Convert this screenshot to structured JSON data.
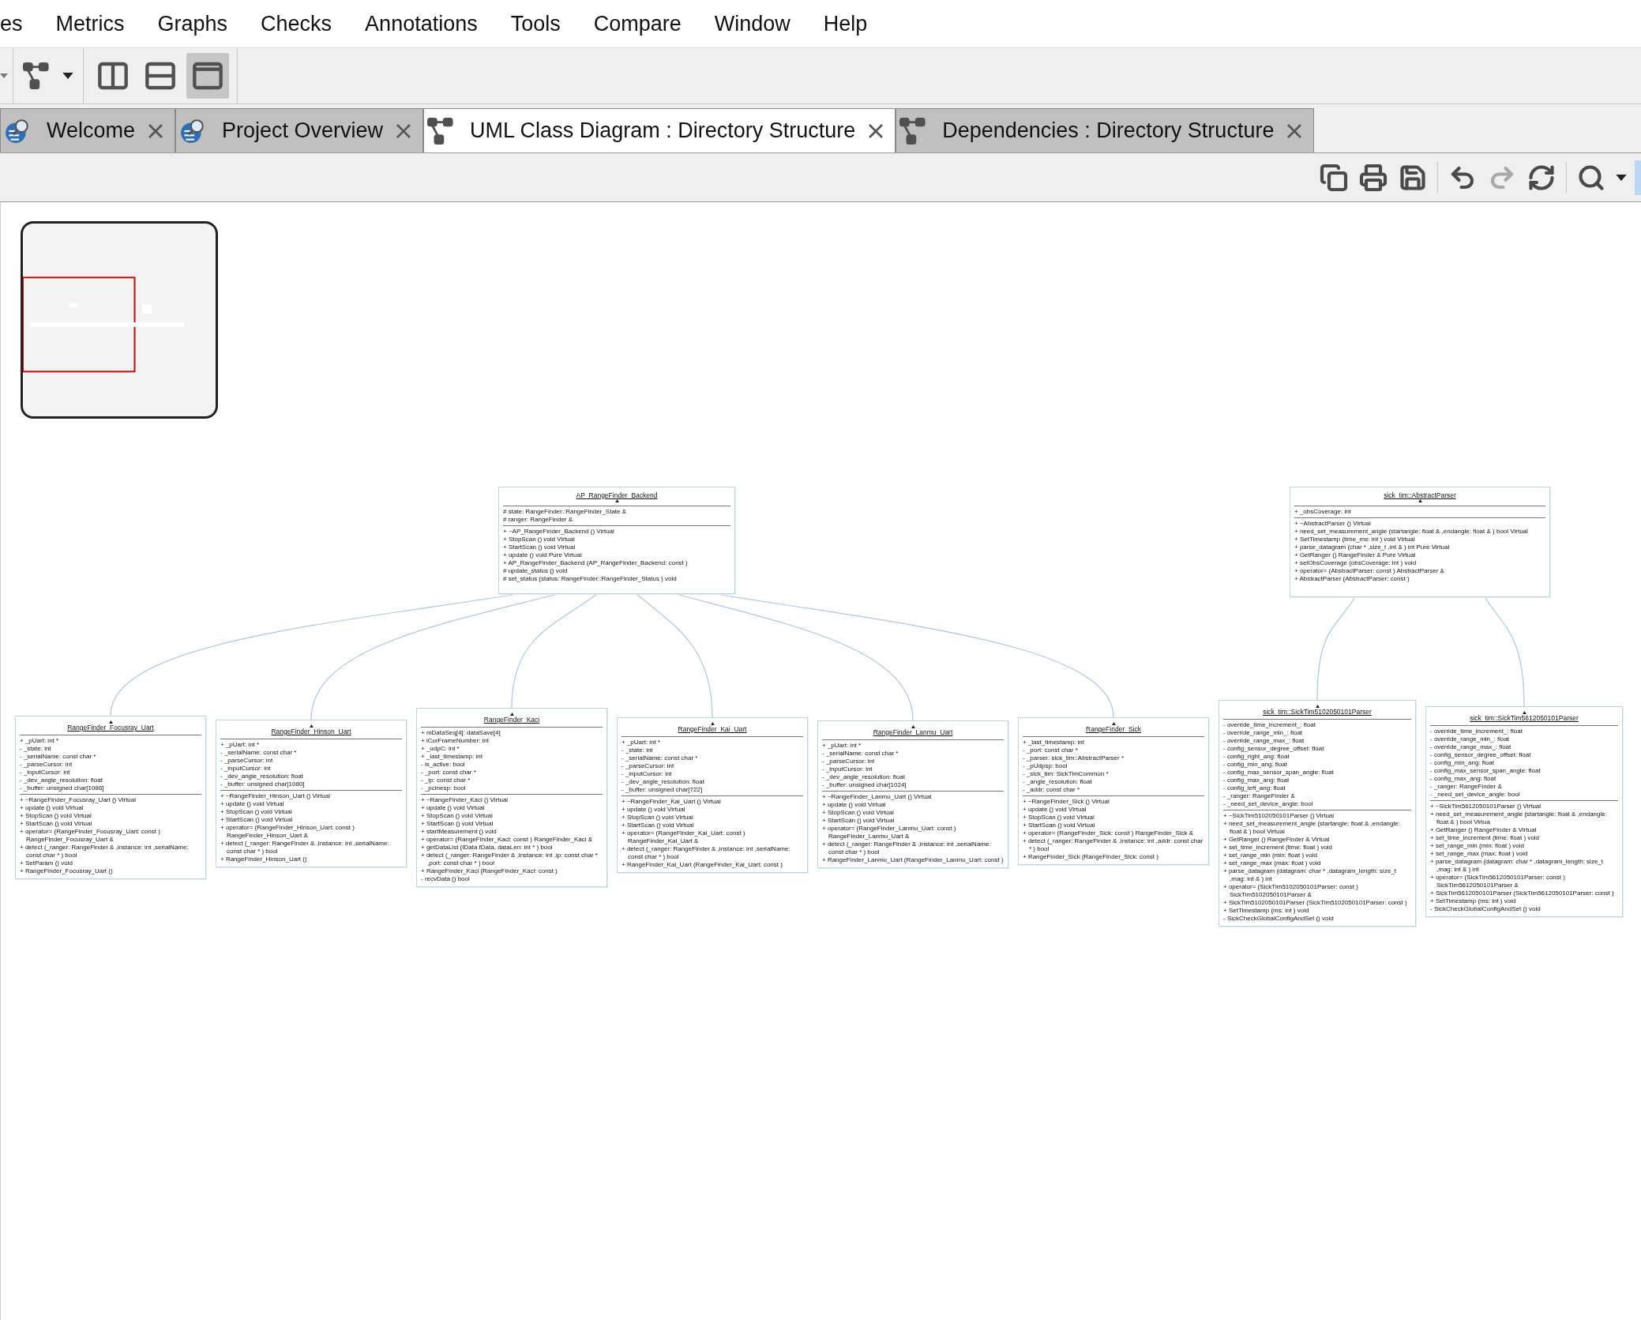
{
  "menu": [
    {
      "label": "es"
    },
    {
      "label": "Metrics"
    },
    {
      "label": "Graphs"
    },
    {
      "label": "Checks"
    },
    {
      "label": "Annotations"
    },
    {
      "label": "Tools"
    },
    {
      "label": "Compare"
    },
    {
      "label": "Window"
    },
    {
      "label": "Help"
    }
  ],
  "view_buttons": [
    {
      "kind": "columns",
      "selected": false
    },
    {
      "kind": "rows",
      "selected": false
    },
    {
      "kind": "single",
      "selected": true
    }
  ],
  "tabs": [
    {
      "label": "Welcome",
      "kind": "overview",
      "selected": false
    },
    {
      "label": "Project Overview",
      "kind": "overview",
      "selected": false
    },
    {
      "label": "UML Class Diagram : Directory Structure",
      "kind": "graph",
      "selected": true
    },
    {
      "label": "Dependencies : Directory Structure",
      "kind": "graph",
      "selected": false
    }
  ],
  "diagram_tools": [
    {
      "kind": "copy",
      "disabled": false
    },
    {
      "kind": "print",
      "disabled": false
    },
    {
      "kind": "save",
      "disabled": false
    },
    {
      "kind": "undo",
      "disabled": false
    },
    {
      "kind": "redo",
      "disabled": true
    },
    {
      "kind": "refresh",
      "disabled": false
    },
    {
      "kind": "search",
      "disabled": false
    }
  ],
  "classes": [
    {
      "name": "AP_RangeFinder_Backend",
      "attributes": [
        "# state: RangeFinder::RangeFinder_State &",
        "# ranger: RangeFinder &"
      ],
      "methods": [
        "+ ~AP_RangeFinder_Backend () Virtual",
        "+ StopScan () void Virtual",
        "+ StartScan () void Virtual",
        "+ update () void Pure Virtual",
        "+ AP_RangeFinder_Backend (AP_RangeFinder_Backend: const )",
        "# update_status () void",
        "# set_status (status: RangeFinder::RangeFinder_Status ) void"
      ],
      "children": [
        {
          "name": "RangeFinder_Focusray_Uart",
          "attributes": [
            "+ _pUart: int *",
            "- _state: int",
            "- _serialName: const char *",
            "- _parseCursor: int",
            "- _inputCursor: int",
            "- _dev_angle_resolution: float",
            "- _buffer: unsigned char[1086]"
          ],
          "methods": [
            "+ ~RangeFinder_Focusray_Uart () Virtual",
            "+ update () void Virtual",
            "+ StopScan () void Virtual",
            "+ StartScan () void Virtual",
            "+ operator= (RangeFinder_Focusray_Uart: const ) RangeFinder_Focusray_Uart &",
            "+ detect (_ranger: RangeFinder & ,instance: int ,serialName: const char * ) bool",
            "+ SetParam () void",
            "+ RangeFinder_Focusray_Uart ()"
          ]
        },
        {
          "name": "RangeFinder_Hinson_Uart",
          "attributes": [
            "+ _pUart: int *",
            "- _serialName: const char *",
            "- _parseCursor: int",
            "- _inputCursor: int",
            "- _dev_angle_resolution: float",
            "- _buffer: unsigned char[1080]"
          ],
          "methods": [
            "+ ~RangeFinder_Hinson_Uart () Virtual",
            "+ update () void Virtual",
            "+ StopScan () void Virtual",
            "+ StartScan () void Virtual",
            "+ operator= (RangeFinder_Hinson_Uart: const ) RangeFinder_Hinson_Uart &",
            "+ detect (_ranger: RangeFinder & ,instance: int ,serialName: const char * ) bool",
            "+ RangeFinder_Hinson_Uart ()"
          ]
        },
        {
          "name": "RangeFinder_Kaci",
          "attributes": [
            "+ mDataSeq[4]: dataSave[4]",
            "+ iCurFrameNumber: int",
            "+ _udpC: int *",
            "+ _last_timestamp: int",
            "- is_active: bool",
            "- _port: const char *",
            "- _ip: const char *",
            "- _pcinesp: bool"
          ],
          "methods": [
            "+ ~RangeFinder_Kaci () Virtual",
            "+ update () void Virtual",
            "+ StopScan () void Virtual",
            "+ StartScan () void Virtual",
            "+ startMeasurement () void",
            "+ operator= (RangeFinder_Kaci: const ) RangeFinder_Kaci &",
            "+ getDataList (IData fData, dataLen: int * ) bool",
            "+ detect (_ranger: RangeFinder & ,instance: int ,ip: const char * ,port: const char * ) bool",
            "+ RangeFinder_Kaci (RangeFinder_Kaci: const )",
            "- recvData () bool"
          ]
        },
        {
          "name": "RangeFinder_Kai_Uart",
          "attributes": [
            "+ _pUart: int *",
            "- _state: int",
            "- _serialName: const char *",
            "- _parseCursor: int",
            "- _inputCursor: int",
            "- _dev_angle_resolution: float",
            "- _buffer: unsigned char[722]"
          ],
          "methods": [
            "+ ~RangeFinder_Kai_Uart () Virtual",
            "+ update () void Virtual",
            "+ StopScan () void Virtual",
            "+ StartScan () void Virtual",
            "+ operator= (RangeFinder_Kai_Uart: const ) RangeFinder_Kai_Uart &",
            "+ detect (_ranger: RangeFinder & ,instance: int ,serialName: const char * ) bool",
            "+ RangeFinder_Kai_Uart (RangeFinder_Kai_Uart: const )"
          ]
        },
        {
          "name": "RangeFinder_Lanmu_Uart",
          "attributes": [
            "+ _pUart: int *",
            "- _serialName: const char *",
            "- _parseCursor: int",
            "- _inputCursor: int",
            "- _dev_angle_resolution: float",
            "- _buffer: unsigned char[1024]"
          ],
          "methods": [
            "+ ~RangeFinder_Lanmu_Uart () Virtual",
            "+ update () void Virtual",
            "+ StopScan () void Virtual",
            "+ StartScan () void Virtual",
            "+ operator= (RangeFinder_Lanmu_Uart: const ) RangeFinder_Lanmu_Uart &",
            "+ detect (_ranger: RangeFinder & ,instance: int ,serialName: const char * ) bool",
            "+ RangeFinder_Lanmu_Uart (RangeFinder_Lanmu_Uart: const )"
          ]
        },
        {
          "name": "RangeFinder_Sick",
          "attributes": [
            "+ _last_timestamp: int",
            "- _port: const char *",
            "- _parser: sick_tim::AbstractParser *",
            "- _pUdpsp: bool",
            "- _sick_tim: SickTimCommon *",
            "- _angle_resolution: float",
            "- _addr: const char *"
          ],
          "methods": [
            "+ ~RangeFinder_Sick () Virtual",
            "+ update () void Virtual",
            "+ StopScan () void Virtual",
            "+ StartScan () void Virtual",
            "+ operator= (RangeFinder_Sick: const ) RangeFinder_Sick &",
            "+ detect (_ranger: RangeFinder & ,instance: int ,addr: const char * ) bool",
            "+ RangeFinder_Sick (RangeFinder_Sick: const )"
          ]
        }
      ]
    },
    {
      "name": "sick_tim::AbstractParser",
      "attributes": [
        "+ _obsCoverage: int"
      ],
      "methods": [
        "+ ~AbstractParser () Virtual",
        "+ need_set_measurement_angle (startangle: float & ,endangle: float & ) bool Virtual",
        "+ SetTimestamp (time_ms: int ) void Virtual",
        "+ parse_datagram (char * ,size_t ,int & ) int Pure Virtual",
        "+ GetRanger () RangeFinder & Pure Virtual",
        "+ setObsCoverage (obsCoverage: int ) void",
        "+ operator= (AbstractParser: const ) AbstractParser &",
        "+ AbstractParser (AbstractParser: const )"
      ],
      "children": [
        {
          "name": "sick_tim::SickTim5102050101Parser",
          "attributes": [
            "- override_time_increment_: float",
            "- override_range_min_: float",
            "- override_range_max_: float",
            "- config_sensor_degree_offset: float",
            "- config_right_ang: float",
            "- config_min_ang: float",
            "- config_max_sensor_span_angle: float",
            "- config_max_ang: float",
            "- config_left_ang: float",
            "- _ranger: RangeFinder &",
            "- _need_set_device_angle: bool"
          ],
          "methods": [
            "+ ~SickTim5102050101Parser () Virtual",
            "+ need_set_measurement_angle (startangle: float & ,endangle: float & ) bool Virtual",
            "+ GetRanger () RangeFinder & Virtual",
            "+ set_time_increment (time: float ) void",
            "+ set_range_min (min: float ) void",
            "+ set_range_max (max: float ) void",
            "+ parse_datagram (datagram: char * ,datagram_length: size_t ,mag: int & ) int",
            "+ operator= (SickTim5102050101Parser: const ) SickTim5102050101Parser &",
            "+ SickTim5102050101Parser (SickTim5102050101Parser: const )",
            "+ SetTimestamp (ms: int ) void",
            "- SickCheckGlobalConfigAndSet () void"
          ]
        },
        {
          "name": "sick_tim::SickTim5612050101Parser",
          "attributes": [
            "- override_time_increment_: float",
            "- override_range_min_: float",
            "- override_range_max_: float",
            "- config_sensor_degree_offset: float",
            "- config_min_ang: float",
            "- config_max_sensor_span_angle: float",
            "- config_max_ang: float",
            "- _ranger: RangeFinder &",
            "- _need_set_device_angle: bool"
          ],
          "methods": [
            "+ ~SickTim5612050101Parser () Virtual",
            "+ need_set_measurement_angle (startangle: float & ,endangle: float & ) bool Virtua",
            "+ GetRanger () RangeFinder & Virtual",
            "+ set_time_increment (time: float ) void",
            "+ set_range_min (min: float ) void",
            "+ set_range_max (max: float ) void",
            "+ parse_datagram (datagram: char * ,datagram_length: size_t ,mag: int & ) int",
            "+ operator= (SickTim5612050101Parser: const ) SickTim5612050101Parser &",
            "+ SickTim5612050101Parser (SickTim5612050101Parser: const )",
            "+ SetTimestamp (ms: int ) void",
            "- SickCheckGlobalConfigAndSet () void"
          ]
        }
      ]
    }
  ]
}
